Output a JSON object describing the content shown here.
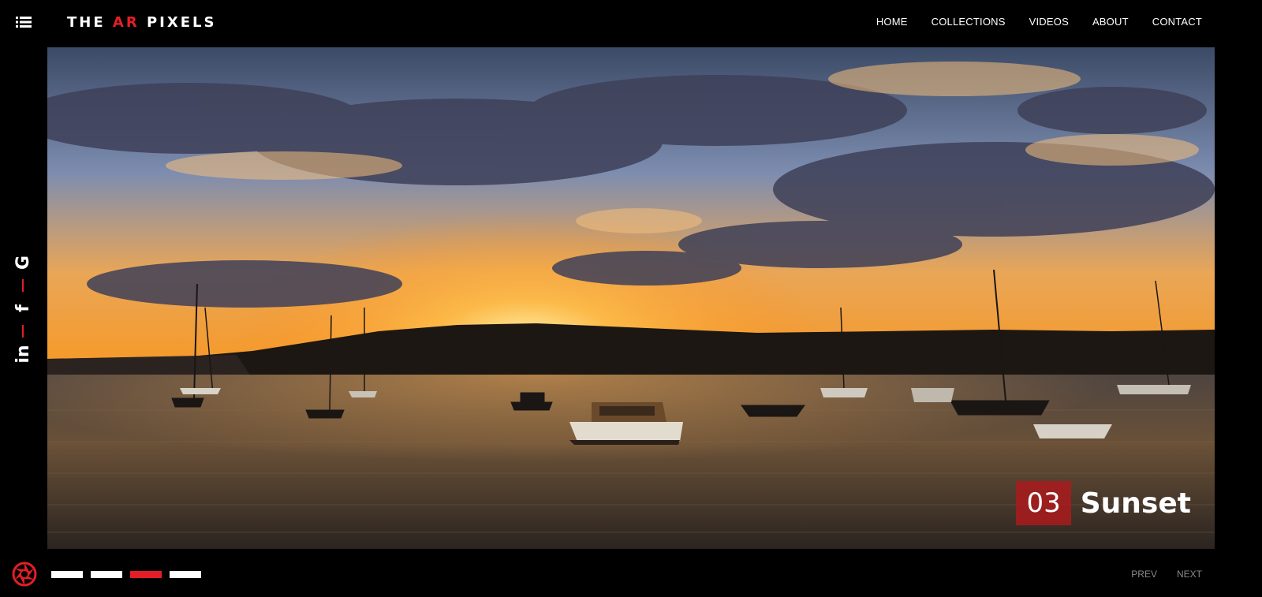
{
  "header": {
    "logo_prefix": "THE ",
    "logo_accent": "AR",
    "logo_suffix": " PIXELS",
    "nav": [
      "HOME",
      "COLLECTIONS",
      "VIDEOS",
      "ABOUT",
      "CONTACT"
    ]
  },
  "social": {
    "icons": [
      "google-icon",
      "facebook-icon",
      "linkedin-icon"
    ],
    "google": "G",
    "facebook": "f",
    "linkedin": "in"
  },
  "slide": {
    "number": "03",
    "title": "Sunset",
    "scene": "harbour-sunset-with-boats"
  },
  "slider": {
    "count": 4,
    "active_index": 2
  },
  "pager": {
    "prev": "PREV",
    "next": "NEXT"
  },
  "colors": {
    "accent": "#e41e26",
    "caption_bg": "#a51c1e",
    "background": "#000000",
    "pager_text": "#8a8a8a"
  }
}
